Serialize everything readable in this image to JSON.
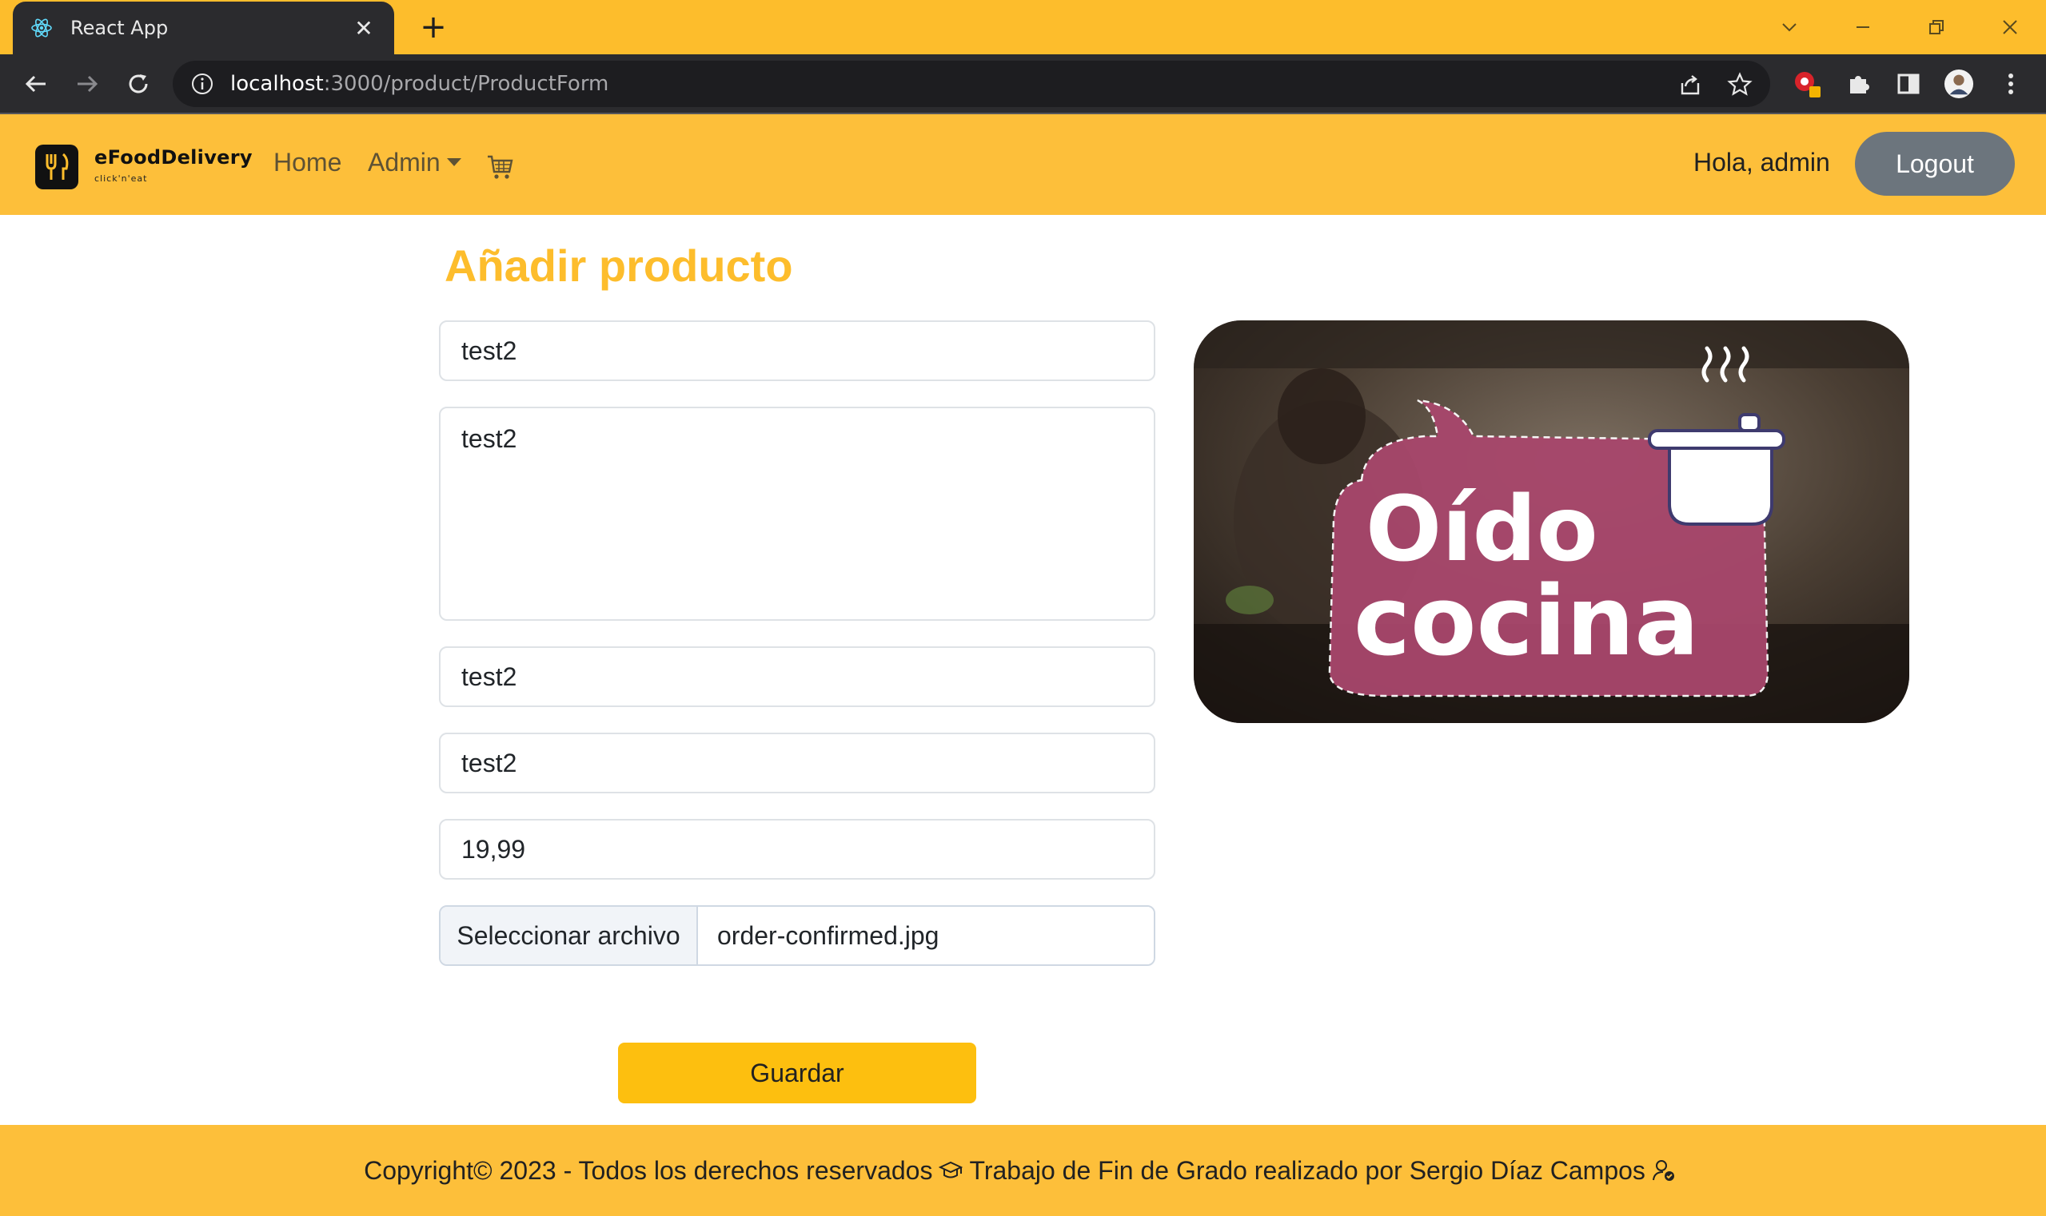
{
  "browser": {
    "tab_title": "React App",
    "url_host": "localhost",
    "url_rest": ":3000/product/ProductForm",
    "accent": "#fdbd2c"
  },
  "navbar": {
    "brand_name": "eFoodDelivery",
    "brand_tagline": "click'n'eat",
    "home_label": "Home",
    "admin_label": "Admin",
    "greeting": "Hola, admin",
    "logout_label": "Logout"
  },
  "form": {
    "title": "Añadir producto",
    "name_value": "test2",
    "description_value": "test2",
    "field3_value": "test2",
    "field4_value": "test2",
    "price_value": "19,99",
    "file_button_label": "Seleccionar archivo",
    "file_name": "order-confirmed.jpg",
    "save_label": "Guardar"
  },
  "preview": {
    "line1": "Oído",
    "line2": "cocina"
  },
  "footer": {
    "text_part1": "Copyright© 2023 - Todos los derechos reservados",
    "text_part2": "Trabajo de Fin de Grado realizado por Sergio Díaz Campos"
  },
  "icons": [
    "react-icon",
    "close-icon",
    "plus-icon",
    "chevron-down-icon",
    "minimize-icon",
    "restore-icon",
    "back-icon",
    "forward-icon",
    "reload-icon",
    "info-icon",
    "share-icon",
    "star-icon",
    "extension-icon",
    "puzzle-icon",
    "sidepanel-icon",
    "profile-icon",
    "menu-icon",
    "fork-knife-icon",
    "cart-icon",
    "graduation-cap-icon",
    "user-check-icon"
  ]
}
